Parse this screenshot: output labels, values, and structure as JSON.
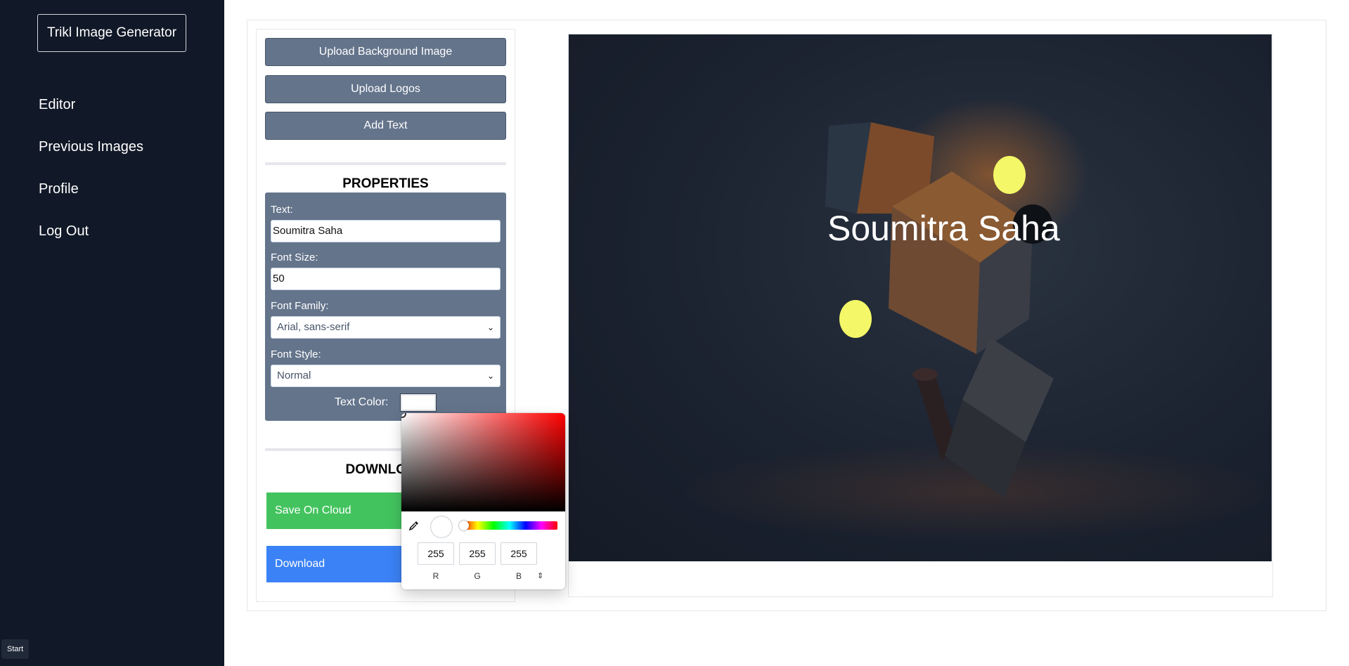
{
  "sidebar": {
    "brand": "Trikl Image Generator",
    "nav": [
      "Editor",
      "Previous Images",
      "Profile",
      "Log Out"
    ],
    "start_label": "Start"
  },
  "panel": {
    "upload_bg": "Upload Background Image",
    "upload_logos": "Upload Logos",
    "add_text": "Add Text",
    "properties_title": "PROPERTIES",
    "text_label": "Text:",
    "text_value": "Soumitra Saha",
    "font_size_label": "Font Size:",
    "font_size_value": "50",
    "font_family_label": "Font Family:",
    "font_family_value": "Arial, sans-serif",
    "font_style_label": "Font Style:",
    "font_style_value": "Normal",
    "text_color_label": "Text Color:",
    "text_color_value": "#ffffff",
    "download_title": "DOWNLOAD",
    "save_cloud": "Save On Cloud",
    "download": "Download"
  },
  "canvas": {
    "overlay_text": "Soumitra Saha"
  },
  "picker": {
    "r": "255",
    "g": "255",
    "b": "255",
    "r_label": "R",
    "g_label": "G",
    "b_label": "B",
    "mode_toggle_icon": "chevron-updown-icon"
  },
  "colors": {
    "sidebar_bg": "#111827",
    "panel_button": "#64748b",
    "save_green": "#43c35e",
    "download_blue": "#3b82f6",
    "logo_yellow": "#f4f868"
  }
}
